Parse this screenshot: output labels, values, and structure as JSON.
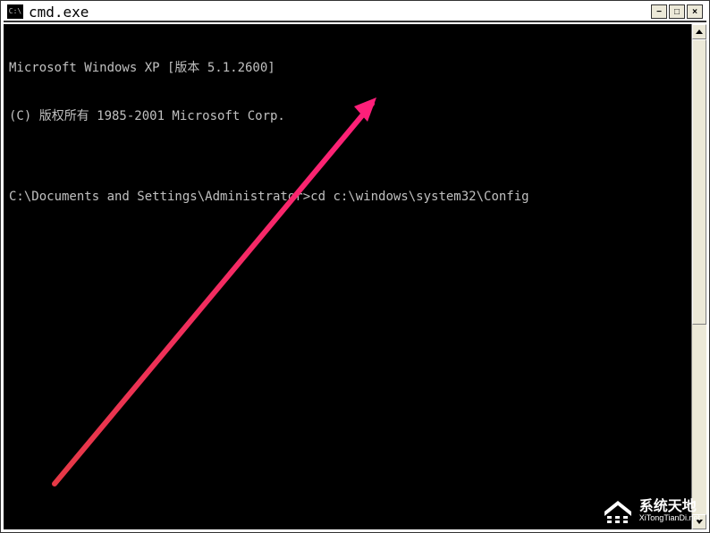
{
  "titlebar": {
    "icon_text": "C:\\",
    "title": "cmd.exe",
    "minimize": "−",
    "maximize": "□",
    "close": "×"
  },
  "console": {
    "line1": "Microsoft Windows XP [版本 5.1.2600]",
    "line2": "(C) 版权所有 1985-2001 Microsoft Corp.",
    "line3": "",
    "line4_prompt": "C:\\Documents and Settings\\Administrator>",
    "line4_command": "cd c:\\windows\\system32\\Config"
  },
  "watermark": {
    "text": "系统天地",
    "url": "XiTongTianDi.net"
  }
}
